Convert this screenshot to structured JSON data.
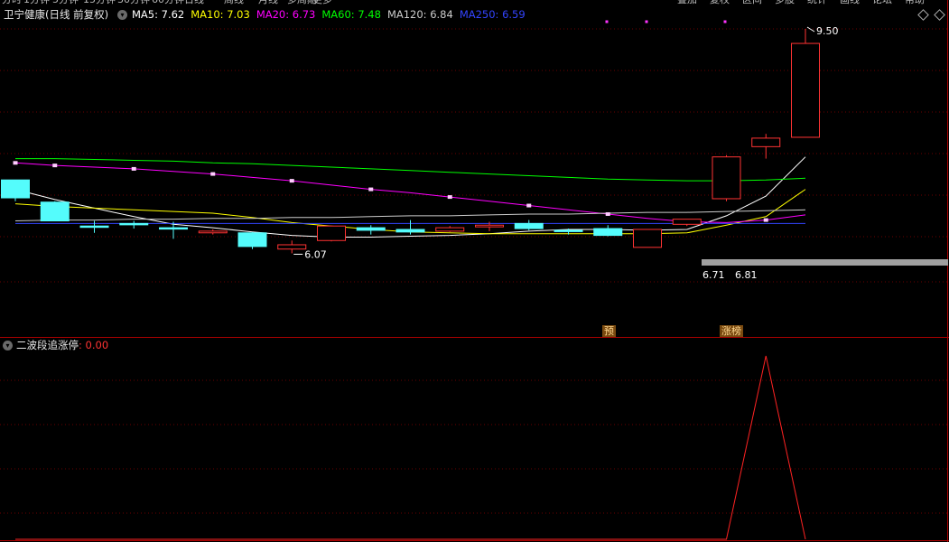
{
  "toolbar": {
    "buttons": [
      "分时",
      "1分钟",
      "5分钟",
      "15分钟",
      "30分钟",
      "60分钟",
      "日线",
      "周线",
      "月线",
      "多周期",
      "更多"
    ],
    "right_buttons": [
      "叠加",
      "复权",
      "区间",
      "多股",
      "统计",
      "画线",
      "论坛",
      "帮助"
    ]
  },
  "main_chart": {
    "stock_name": "卫宁健康",
    "period_label": "(日线 前复权)",
    "ma": [
      {
        "label": "MA5: 7.62",
        "color": "#ffffff"
      },
      {
        "label": "MA10: 7.03",
        "color": "#ffff00"
      },
      {
        "label": "MA20: 6.73",
        "color": "#ff00ff"
      },
      {
        "label": "MA60: 7.48",
        "color": "#00ff00"
      },
      {
        "label": "MA120: 6.84",
        "color": "#cccccc"
      },
      {
        "label": "MA250: 6.59",
        "color": "#3344ff"
      }
    ],
    "high_label": "9.50",
    "low_label": "6.07",
    "price_labels": [
      "6.71",
      "6.81"
    ],
    "tags": [
      "预",
      "涨榜"
    ]
  },
  "indicator": {
    "name": "二波段追涨停",
    "value": ": 0.00",
    "value_color": "#ff3333"
  },
  "chart_data": {
    "type": "candlestick",
    "title": "卫宁健康 (日线 前复权)",
    "up_color": "#ff3333",
    "down_color": "#54fcfc",
    "candles": [
      {
        "open": 7.73,
        "close": 7.52,
        "high": 7.73,
        "low": 7.48
      },
      {
        "open": 7.47,
        "close": 7.25,
        "high": 7.48,
        "low": 7.25
      },
      {
        "open": 7.19,
        "close": 7.18,
        "high": 7.25,
        "low": 7.11
      },
      {
        "open": 7.22,
        "close": 7.21,
        "high": 7.25,
        "low": 7.16
      },
      {
        "open": 7.17,
        "close": 7.16,
        "high": 7.24,
        "low": 7.04
      },
      {
        "open": 7.11,
        "close": 7.13,
        "high": 7.15,
        "low": 7.09
      },
      {
        "open": 7.11,
        "close": 6.95,
        "high": 7.12,
        "low": 6.92
      },
      {
        "open": 6.92,
        "close": 6.97,
        "high": 7.02,
        "low": 6.87
      },
      {
        "open": 7.02,
        "close": 7.19,
        "high": 7.19,
        "low": 7.01
      },
      {
        "open": 7.17,
        "close": 7.14,
        "high": 7.2,
        "low": 7.09
      },
      {
        "open": 7.15,
        "close": 7.12,
        "high": 7.26,
        "low": 7.09
      },
      {
        "open": 7.13,
        "close": 7.17,
        "high": 7.19,
        "low": 7.12
      },
      {
        "open": 7.18,
        "close": 7.2,
        "high": 7.24,
        "low": 7.13
      },
      {
        "open": 7.22,
        "close": 7.16,
        "high": 7.26,
        "low": 7.14
      },
      {
        "open": 7.14,
        "close": 7.13,
        "high": 7.16,
        "low": 7.09
      },
      {
        "open": 7.16,
        "close": 7.08,
        "high": 7.2,
        "low": 7.07
      },
      {
        "open": 6.94,
        "close": 7.15,
        "high": 7.15,
        "low": 6.94
      },
      {
        "open": 7.21,
        "close": 7.27,
        "high": 7.27,
        "low": 7.19
      },
      {
        "open": 7.51,
        "close": 8.0,
        "high": 8.02,
        "low": 7.48
      },
      {
        "open": 8.12,
        "close": 8.22,
        "high": 8.27,
        "low": 7.98
      },
      {
        "open": 8.23,
        "close": 9.33,
        "high": 9.5,
        "low": 8.23
      }
    ],
    "series": [
      {
        "name": "MA5",
        "color": "#ffffff",
        "values": [
          7.62,
          7.5,
          7.4,
          7.3,
          7.21,
          7.17,
          7.12,
          7.08,
          7.06,
          7.06,
          7.07,
          7.08,
          7.1,
          7.13,
          7.15,
          7.15,
          7.14,
          7.15,
          7.31,
          7.54,
          8.0
        ]
      },
      {
        "name": "MA10",
        "color": "#ffff00",
        "values": [
          7.45,
          7.42,
          7.4,
          7.38,
          7.36,
          7.34,
          7.29,
          7.23,
          7.19,
          7.15,
          7.12,
          7.11,
          7.1,
          7.1,
          7.1,
          7.1,
          7.1,
          7.11,
          7.2,
          7.3,
          7.62
        ]
      },
      {
        "name": "MA20",
        "color": "#ff00ff",
        "values": [
          7.93,
          7.9,
          7.88,
          7.86,
          7.83,
          7.8,
          7.76,
          7.72,
          7.67,
          7.62,
          7.58,
          7.53,
          7.48,
          7.43,
          7.38,
          7.33,
          7.28,
          7.24,
          7.23,
          7.26,
          7.32
        ]
      },
      {
        "name": "MA60",
        "color": "#00ff00",
        "values": [
          7.98,
          7.98,
          7.97,
          7.96,
          7.95,
          7.93,
          7.92,
          7.9,
          7.88,
          7.86,
          7.84,
          7.82,
          7.8,
          7.78,
          7.76,
          7.74,
          7.73,
          7.72,
          7.72,
          7.73,
          7.75
        ]
      },
      {
        "name": "MA120",
        "color": "#cccccc",
        "values": [
          7.25,
          7.26,
          7.26,
          7.27,
          7.27,
          7.28,
          7.28,
          7.29,
          7.29,
          7.3,
          7.31,
          7.31,
          7.32,
          7.33,
          7.33,
          7.34,
          7.35,
          7.35,
          7.36,
          7.37,
          7.38
        ]
      },
      {
        "name": "MA250",
        "color": "#3344ff",
        "values": [
          7.22,
          7.22,
          7.22,
          7.22,
          7.22,
          7.22,
          7.22,
          7.22,
          7.22,
          7.22,
          7.22,
          7.22,
          7.22,
          7.22,
          7.22,
          7.22,
          7.22,
          7.22,
          7.22,
          7.22,
          7.22
        ]
      }
    ],
    "indicator_series": {
      "name": "二波段追涨停",
      "color": "#ff2222",
      "values": [
        0,
        0,
        0,
        0,
        0,
        0,
        0,
        0,
        0,
        0,
        0,
        0,
        0,
        0,
        0,
        0,
        0,
        0,
        0,
        1,
        0
      ]
    }
  }
}
